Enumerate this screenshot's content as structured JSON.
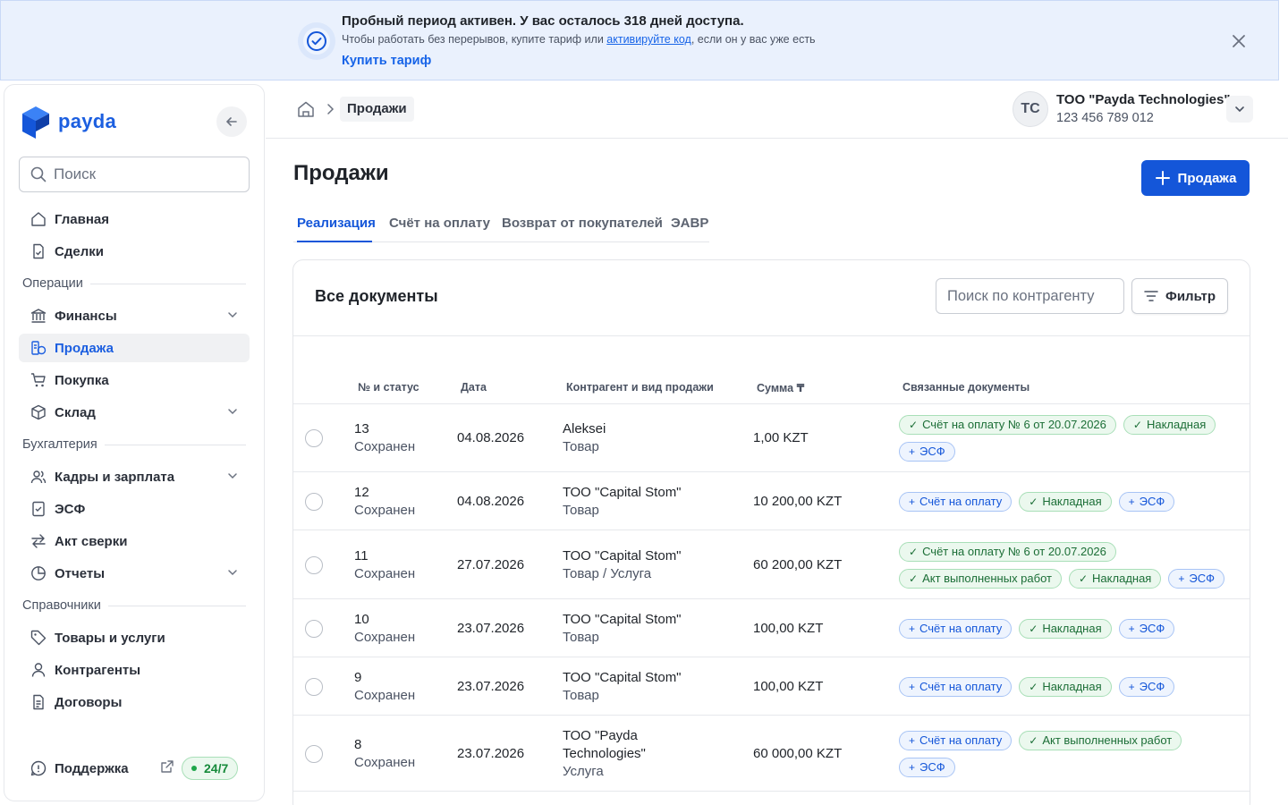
{
  "banner": {
    "title": "Пробный период активен. У вас осталось 318 дней доступа.",
    "sub_before": "Чтобы работать без перерывов, купите тариф или ",
    "sub_link": "активируйте код",
    "sub_after": ", если он у вас уже есть",
    "buy_label": "Купить тариф"
  },
  "brand": {
    "name": "payda",
    "color": "#1c5fe0"
  },
  "sidebar": {
    "search_placeholder": "Поиск",
    "items": {
      "home": "Главная",
      "deals": "Сделки",
      "section_ops": "Операции",
      "finance": "Финансы",
      "sales": "Продажа",
      "purchase": "Покупка",
      "warehouse": "Склад",
      "section_acc": "Бухгалтерия",
      "hr": "Кадры и зарплата",
      "esf": "ЭСФ",
      "reconciliation": "Акт сверки",
      "reports": "Отчеты",
      "section_ref": "Справочники",
      "products": "Товары и услуги",
      "counterparties": "Контрагенты",
      "contracts": "Договоры"
    },
    "support": "Поддержка",
    "support_badge": "24/7"
  },
  "header": {
    "breadcrumb_current": "Продажи",
    "avatar_initials": "TC",
    "org_name": "ТОО \"Payda Technologies\"",
    "org_bin": "123 456 789 012"
  },
  "main": {
    "title": "Продажи",
    "add_button": "Продажа",
    "tabs": [
      "Реализация",
      "Счёт на оплату",
      "Возврат от покупателей",
      "ЭАВР"
    ],
    "active_tab": "Реализация",
    "card_title": "Все документы",
    "counterparty_search_placeholder": "Поиск по контрагенту",
    "filter_label": "Фильтр",
    "columns": [
      "№ и статус",
      "Дата",
      "Контрагент и вид продажи",
      "Сумма ₸",
      "Связанные документы"
    ],
    "rows": [
      {
        "num": "13",
        "status": "Сохранен",
        "date": "04.08.2026",
        "counterparty": "Aleksei",
        "kind": "Товар",
        "amount": "1,00 KZT",
        "docs": [
          {
            "t": "Счёт на оплату № 6 от 20.07.2026",
            "done": true
          },
          {
            "t": "Накладная",
            "done": true
          },
          {
            "t": "ЭСФ",
            "done": false
          }
        ]
      },
      {
        "num": "12",
        "status": "Сохранен",
        "date": "04.08.2026",
        "counterparty": "ТОО \"Capital Stom\"",
        "kind": "Товар",
        "amount": "10 200,00 KZT",
        "docs": [
          {
            "t": "Счёт на оплату",
            "done": false
          },
          {
            "t": "Накладная",
            "done": true
          },
          {
            "t": "ЭСФ",
            "done": false
          }
        ]
      },
      {
        "num": "11",
        "status": "Сохранен",
        "date": "27.07.2026",
        "counterparty": "ТОО \"Capital Stom\"",
        "kind": "Товар / Услуга",
        "amount": "60 200,00 KZT",
        "docs": [
          {
            "t": "Счёт на оплату № 6 от 20.07.2026",
            "done": true
          },
          {
            "t": "Акт выполненных работ",
            "done": true
          },
          {
            "t": "Накладная",
            "done": true
          },
          {
            "t": "ЭСФ",
            "done": false
          }
        ]
      },
      {
        "num": "10",
        "status": "Сохранен",
        "date": "23.07.2026",
        "counterparty": "ТОО \"Capital Stom\"",
        "kind": "Товар",
        "amount": "100,00 KZT",
        "docs": [
          {
            "t": "Счёт на оплату",
            "done": false
          },
          {
            "t": "Накладная",
            "done": true
          },
          {
            "t": "ЭСФ",
            "done": false
          }
        ]
      },
      {
        "num": "9",
        "status": "Сохранен",
        "date": "23.07.2026",
        "counterparty": "ТОО \"Capital Stom\"",
        "kind": "Товар",
        "amount": "100,00 KZT",
        "docs": [
          {
            "t": "Счёт на оплату",
            "done": false
          },
          {
            "t": "Накладная",
            "done": true
          },
          {
            "t": "ЭСФ",
            "done": false
          }
        ]
      },
      {
        "num": "8",
        "status": "Сохранен",
        "date": "23.07.2026",
        "counterparty": "ТОО \"Payda Technologies\"",
        "kind": "Услуга",
        "amount": "60 000,00 KZT",
        "docs": [
          {
            "t": "Счёт на оплату",
            "done": false
          },
          {
            "t": "Акт выполненных работ",
            "done": true
          },
          {
            "t": "ЭСФ",
            "done": false
          }
        ]
      }
    ]
  },
  "colors": {
    "accent": "#1456d9",
    "done_tag": "#ebf8ee",
    "add_tag": "#eef4fe",
    "banner_bg": "#eaf1fd"
  }
}
